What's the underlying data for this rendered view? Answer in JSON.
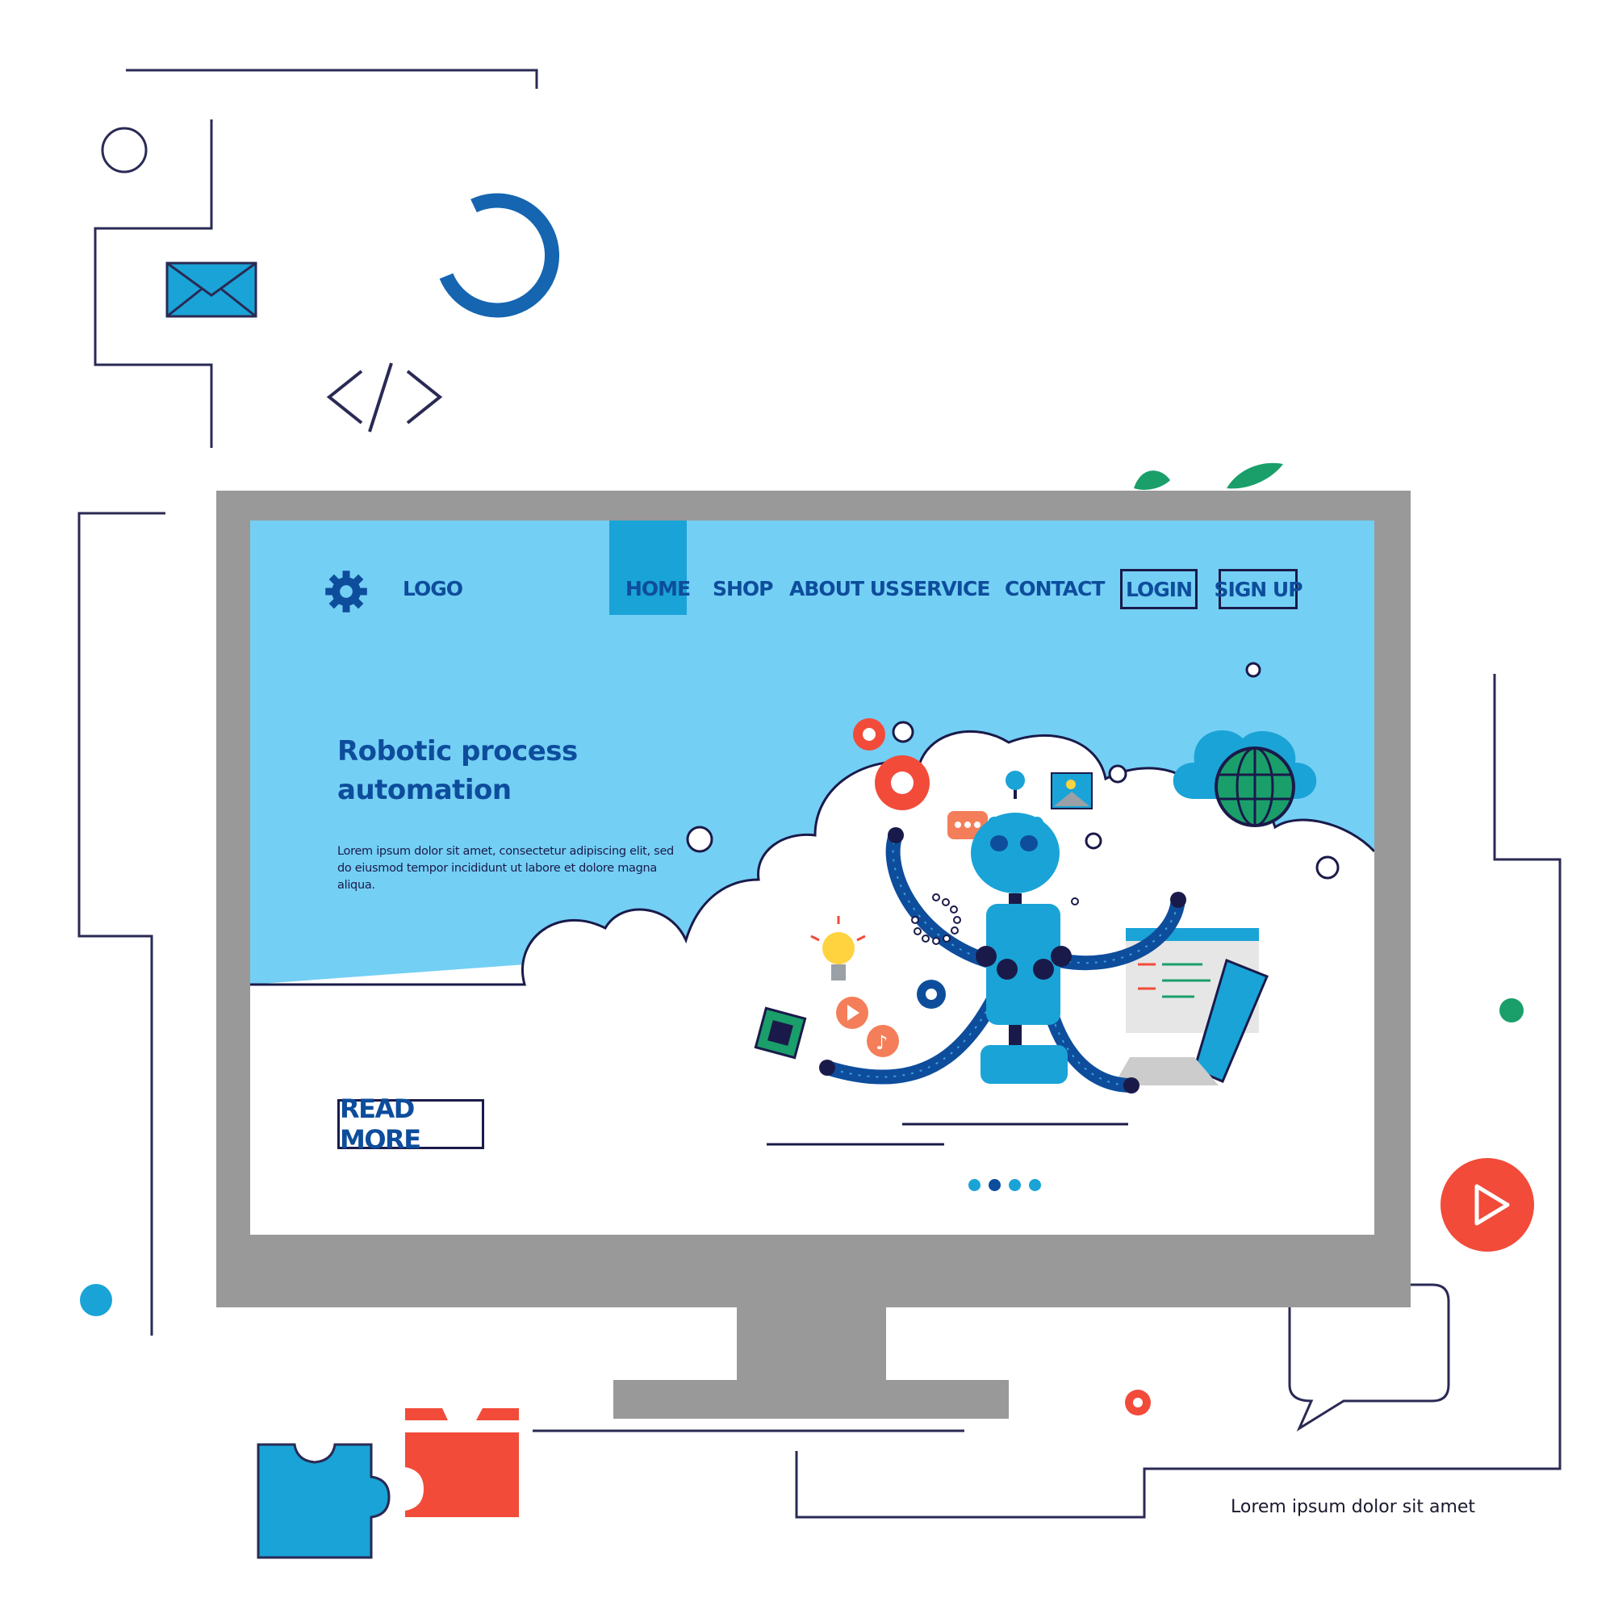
{
  "site": {
    "logo_label": "LOGO",
    "nav": [
      {
        "label": "HOME",
        "active": true
      },
      {
        "label": "SHOP"
      },
      {
        "label": "ABOUT US"
      },
      {
        "label": "SERVICE"
      },
      {
        "label": "CONTACT"
      }
    ],
    "login_label": "LOGIN",
    "signup_label": "SIGN UP"
  },
  "hero": {
    "title": "Robotic process automation",
    "body": "Lorem ipsum dolor sit amet, consectetur adipiscing elit, sed do eiusmod tempor incididunt ut labore et dolore magna aliqua.",
    "cta_label": "READ MORE"
  },
  "carousel": {
    "count": 4,
    "active_index": 1
  },
  "footer": {
    "text": "Lorem ipsum dolor sit amet"
  },
  "icons": [
    "gear-icon",
    "envelope-icon",
    "code-icon",
    "play-icon",
    "chat-bubble-icon",
    "puzzle-icon",
    "robot-illustration",
    "globe-icon",
    "lightbulb-icon",
    "music-note-icon",
    "image-icon",
    "chip-icon",
    "laptop-icon"
  ],
  "colors": {
    "sky": "#74cff4",
    "brand_blue": "#0d4d9c",
    "accent_blue": "#1aa3d6",
    "red": "#f24b3a",
    "green": "#1a9f6a",
    "monitor_gray": "#999999",
    "outline": "#1a1a4a"
  }
}
